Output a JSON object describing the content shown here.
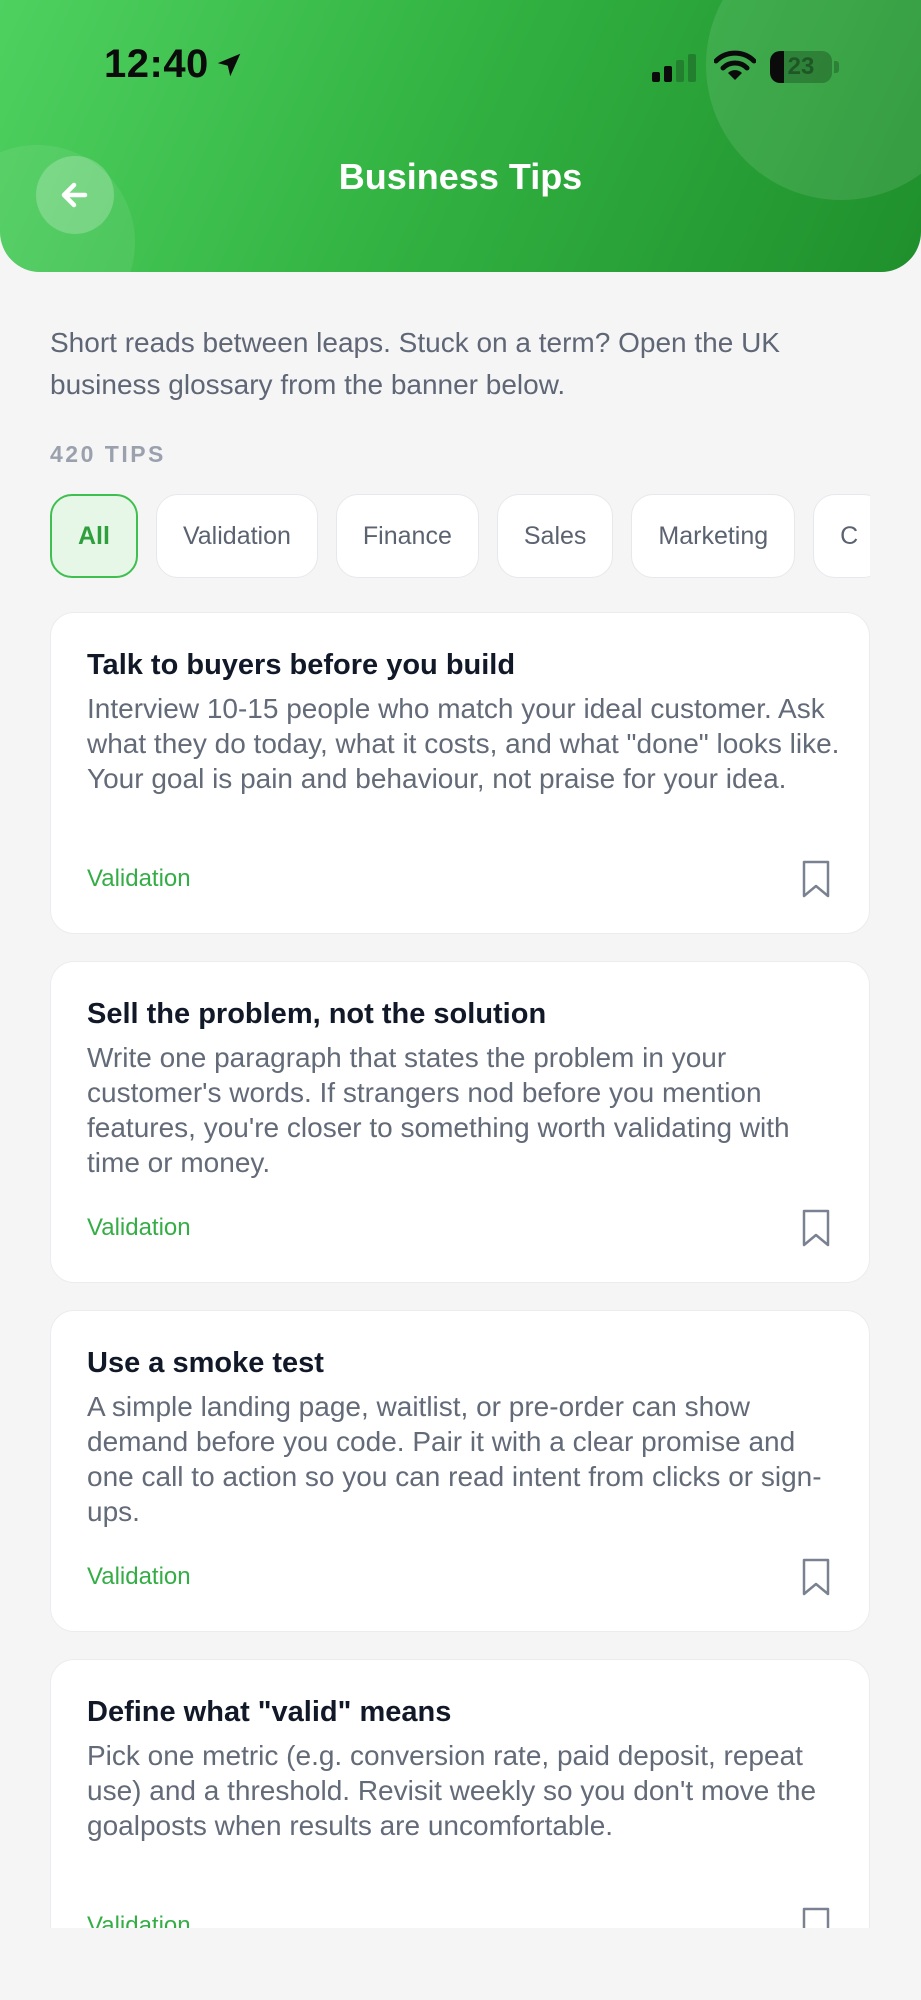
{
  "status_bar": {
    "time": "12:40",
    "battery": "23",
    "battery_level": 0.23
  },
  "header": {
    "title": "Business Tips",
    "back_icon": "arrow-left-icon"
  },
  "intro": "Short reads between leaps. Stuck on a term? Open the UK business glossary from the banner below.",
  "count_label": "420 TIPS",
  "chips": [
    "All",
    "Validation",
    "Finance",
    "Sales",
    "Marketing",
    "C"
  ],
  "active_chip": "All",
  "tips": [
    {
      "title": "Talk to buyers before you build",
      "body": "Interview 10-15 people who match your ideal customer. Ask what they do today, what it costs, and what \"done\" looks like. Your goal is pain and behaviour, not praise for your idea.",
      "tag": "Validation"
    },
    {
      "title": "Sell the problem, not the solution",
      "body": "Write one paragraph that states the problem in your customer's words. If strangers nod before you mention features, you're closer to something worth validating with time or money.",
      "tag": "Validation"
    },
    {
      "title": "Use a smoke test",
      "body": "A simple landing page, waitlist, or pre-order can show demand before you code. Pair it with a clear promise and one call to action so you can read intent from clicks or sign-ups.",
      "tag": "Validation"
    },
    {
      "title": "Define what \"valid\" means",
      "body": "Pick one metric (e.g. conversion rate, paid deposit, repeat use) and a threshold. Revisit weekly so you don't move the goalposts when results are uncomfortable.",
      "tag": "Validation"
    }
  ],
  "colors": {
    "accent": "#35ad46",
    "header_start": "#4fd160",
    "header_end": "#1f8f2c"
  }
}
